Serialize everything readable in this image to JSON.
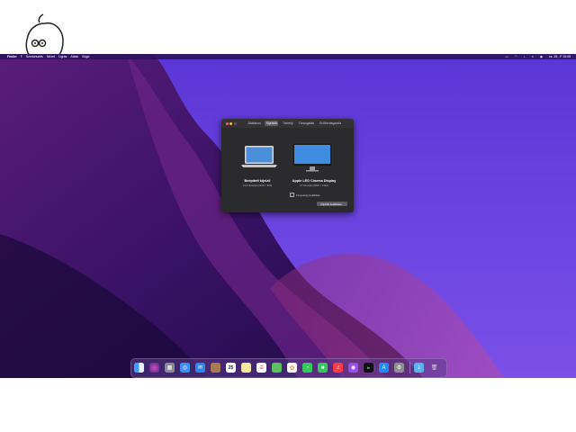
{
  "menubar": {
    "apple": "",
    "items": [
      "Finder",
      "F",
      "Szerkesztés",
      "Nézet",
      "Ugrás",
      "Ablak",
      "Súgó"
    ],
    "clock": "cs. 25., F 19:05"
  },
  "window": {
    "tabs": [
      "Általános",
      "Kijelzők",
      "Tárhely",
      "Támogatás",
      "Erőforrásgazda"
    ],
    "active_tab_index": 1,
    "display1": {
      "name": "Beépített kijelző",
      "sub": "13,3 hüvelyk (1440 × 900)"
    },
    "display2": {
      "name": "Apple LED Cinema Display",
      "sub": "27 hüvelyk (2560 × 1440)"
    },
    "checkbox_label": "Fényesség beállítása",
    "button_label": "Kijelzők beállításai..."
  },
  "dock": {
    "calendar_date": "25",
    "apps": [
      "finder",
      "siri",
      "launchpad",
      "safari",
      "mail",
      "contacts",
      "calendar",
      "notes",
      "reminders",
      "maps",
      "photos",
      "messages",
      "facetime",
      "music",
      "podcasts",
      "tv",
      "appstore",
      "settings",
      "folder",
      "trash"
    ]
  }
}
